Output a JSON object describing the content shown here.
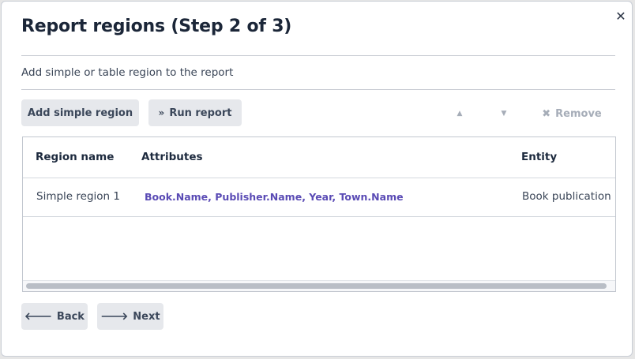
{
  "dialog": {
    "title": "Report regions (Step 2 of 3)",
    "subtitle": "Add simple or table region to the report"
  },
  "toolbar": {
    "add_simple_label": "Add simple region",
    "run_report_label": "Run report",
    "remove_label": "Remove"
  },
  "table": {
    "columns": [
      "Region name",
      "Attributes",
      "Entity"
    ],
    "rows": [
      {
        "region_name": "Simple region 1",
        "attributes": "Book.Name, Publisher.Name, Year, Town.Name",
        "entity": "Book publication"
      }
    ]
  },
  "footer": {
    "back_label": "Back",
    "next_label": "Next"
  },
  "colors": {
    "accent_link": "#5a4bb5",
    "button_bg": "#e6e8ec",
    "disabled": "#a6adb8"
  },
  "icons": [
    "close-icon",
    "double-chevron-right-icon",
    "caret-up-icon",
    "caret-down-icon",
    "remove-x-icon",
    "arrow-left-icon",
    "arrow-right-icon"
  ]
}
